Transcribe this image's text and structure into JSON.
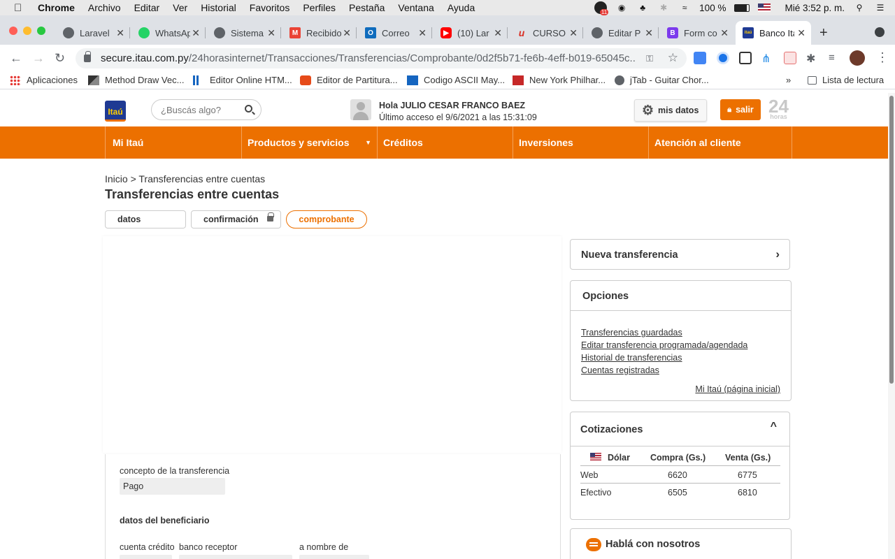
{
  "menubar": {
    "app": "Chrome",
    "items": [
      "Archivo",
      "Editar",
      "Ver",
      "Historial",
      "Favoritos",
      "Perfiles",
      "Pestaña",
      "Ventana",
      "Ayuda"
    ],
    "battery": "100 %",
    "clock": "Mié 3:52 p. m.",
    "badge": "11"
  },
  "tabs": [
    {
      "label": "Laravel",
      "color": "#5f6368"
    },
    {
      "label": "WhatsApp",
      "color": "#25d366"
    },
    {
      "label": "Sistema",
      "color": "#5f6368"
    },
    {
      "label": "Recibidos",
      "color": "#ea4335"
    },
    {
      "label": "Correo",
      "color": "#0f6cbd"
    },
    {
      "label": "(10) Lar",
      "color": "#ff0000"
    },
    {
      "label": "CURSO",
      "color": "#d93025"
    },
    {
      "label": "Editar P",
      "color": "#5f6368"
    },
    {
      "label": "Form co",
      "color": "#7c3aed"
    },
    {
      "label": "Banco Itaú",
      "color": "#1f3a93",
      "active": true
    }
  ],
  "url": {
    "host": "secure.itau.com.py",
    "path": "/24horasinternet/Transacciones/Transferencias/Comprobante/0d2f5b71-fe6b-4eff-b019-65045c..."
  },
  "bookmarks": [
    {
      "label": "Aplicaciones"
    },
    {
      "label": "Method Draw Vec..."
    },
    {
      "label": "Editor Online HTM..."
    },
    {
      "label": "Editor de Partitura..."
    },
    {
      "label": "Codigo ASCII May..."
    },
    {
      "label": "New York Philhar..."
    },
    {
      "label": "jTab - Guitar Chor..."
    }
  ],
  "reading_list": "Lista de lectura",
  "bookmarks_more": "»",
  "header": {
    "logo": "Itaú",
    "search_placeholder": "¿Buscás algo?",
    "greeting": "Hola JULIO CESAR FRANCO BAEZ",
    "last_access": "Último acceso el 9/6/2021 a las 15:31:09",
    "mis_datos": "mis datos",
    "salir": "salir",
    "brand24": "24",
    "brand24_sub": "horas"
  },
  "nav": [
    "Mi Itaú",
    "Productos y servicios",
    "Créditos",
    "Inversiones",
    "Atención al cliente"
  ],
  "breadcrumb": "Inicio > Transferencias entre cuentas",
  "title": "Transferencias entre cuentas",
  "steps": [
    "datos",
    "confirmación",
    "comprobante"
  ],
  "form": {
    "concepto_label": "concepto de la transferencia",
    "concepto_value": "Pago",
    "beneficiario_head": "datos del beneficiario",
    "cuenta_credito_label": "cuenta crédito",
    "banco_receptor_label": "banco receptor",
    "a_nombre_label": "a nombre de"
  },
  "sidebar": {
    "nueva_transferencia": "Nueva transferencia",
    "opciones_title": "Opciones",
    "opciones_links": [
      "Transferencias guardadas",
      "Editar transferencia programada/agendada",
      "Historial de transferencias",
      "Cuentas registradas"
    ],
    "home_link": "Mi Itaú (página inicial)",
    "cotizaciones_title": "Cotizaciones",
    "cotizaciones_headers": [
      "Dólar",
      "Compra (Gs.)",
      "Venta (Gs.)"
    ],
    "cotizaciones_rows": [
      {
        "tipo": "Web",
        "compra": "6620",
        "venta": "6775"
      },
      {
        "tipo": "Efectivo",
        "compra": "6505",
        "venta": "6810"
      }
    ],
    "chat_title": "Hablá con nosotros"
  },
  "colors": {
    "brand_orange": "#ec7000",
    "brand_blue": "#1f3a93"
  }
}
